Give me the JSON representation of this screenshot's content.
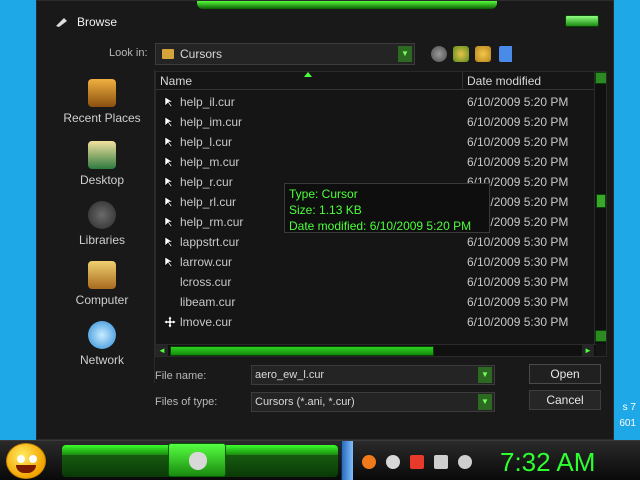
{
  "window": {
    "title": "Browse"
  },
  "toolbar": {
    "look_in_label": "Look in:",
    "look_in_value": "Cursors"
  },
  "places": [
    {
      "label": "Recent Places",
      "icon": "recent-places-icon",
      "color": "#d0881e"
    },
    {
      "label": "Desktop",
      "icon": "desktop-icon",
      "color": "#2e7a3e"
    },
    {
      "label": "Libraries",
      "icon": "libraries-icon",
      "color": "#4a4a4a"
    },
    {
      "label": "Computer",
      "icon": "computer-icon",
      "color": "#c89a3a"
    },
    {
      "label": "Network",
      "icon": "network-icon",
      "color": "#4ab6ff"
    }
  ],
  "list": {
    "columns": {
      "name": "Name",
      "date": "Date modified"
    },
    "rows": [
      {
        "name": "help_il.cur",
        "date": "6/10/2009 5:20 PM"
      },
      {
        "name": "help_im.cur",
        "date": "6/10/2009 5:20 PM"
      },
      {
        "name": "help_l.cur",
        "date": "6/10/2009 5:20 PM"
      },
      {
        "name": "help_m.cur",
        "date": "6/10/2009 5:20 PM"
      },
      {
        "name": "help_r.cur",
        "date": "6/10/2009 5:20 PM"
      },
      {
        "name": "help_rl.cur",
        "date": "6/10/2009 5:20 PM"
      },
      {
        "name": "help_rm.cur",
        "date": "6/10/2009 5:20 PM"
      },
      {
        "name": "lappstrt.cur",
        "date": "6/10/2009 5:30 PM"
      },
      {
        "name": "larrow.cur",
        "date": "6/10/2009 5:30 PM"
      },
      {
        "name": "lcross.cur",
        "date": "6/10/2009 5:30 PM"
      },
      {
        "name": "libeam.cur",
        "date": "6/10/2009 5:30 PM"
      },
      {
        "name": "lmove.cur",
        "date": "6/10/2009 5:30 PM"
      }
    ]
  },
  "tooltip": {
    "type": "Type: Cursor",
    "size": "Size: 1.13 KB",
    "modified": "Date modified: 6/10/2009 5:20 PM"
  },
  "form": {
    "file_name_label": "File name:",
    "file_name_value": "aero_ew_l.cur",
    "file_type_label": "Files of type:",
    "file_type_value": "Cursors (*.ani, *.cur)"
  },
  "buttons": {
    "open": "Open",
    "cancel": "Cancel"
  },
  "taskbar": {
    "clock": "7:32 AM"
  },
  "desktop": {
    "edge_text_1": "s 7",
    "edge_text_2": "601"
  },
  "colors": {
    "accent": "#2eff2e",
    "tooltip_text": "#4cff3a"
  }
}
